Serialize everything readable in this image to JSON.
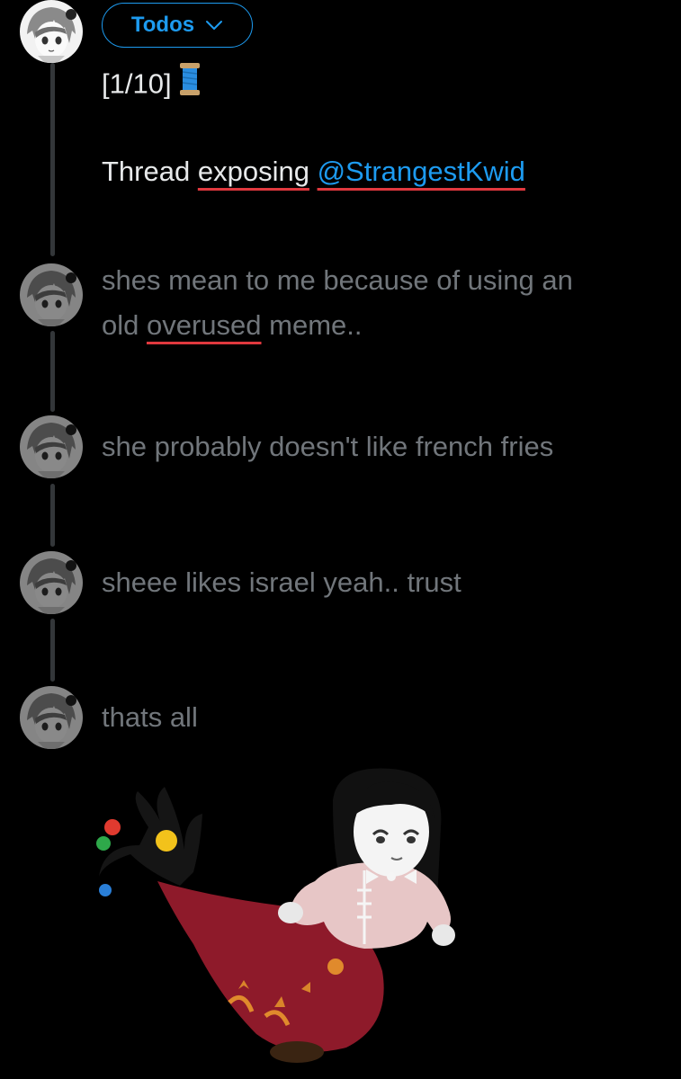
{
  "composer": {
    "audience_label": "Todos",
    "audience_icon": "chevron-down-icon",
    "accent_color": "#1d9bf0",
    "spellcheck_color": "#e0383e"
  },
  "thread": [
    {
      "avatar": "anime-avatar",
      "active": true,
      "line1": {
        "counter": "[1/10]",
        "emoji": "spool-of-thread-icon"
      },
      "line2": {
        "prefix": "Thread ",
        "underlined_word": "exposing",
        "space": " ",
        "mention": "@StrangestKwid"
      }
    },
    {
      "avatar": "anime-avatar",
      "active": false,
      "line1": "shes mean to me because of using an",
      "line2": {
        "prefix": "old ",
        "underlined_word": "overused",
        "suffix": " meme.."
      }
    },
    {
      "avatar": "anime-avatar",
      "active": false,
      "text": "she probably doesn't like french fries"
    },
    {
      "avatar": "anime-avatar",
      "active": false,
      "text": "sheee likes israel yeah.. trust"
    },
    {
      "avatar": "anime-avatar",
      "active": false,
      "text": "thats all"
    }
  ],
  "attached_image": {
    "description_icon": "mermaid-plush-doll-image"
  }
}
